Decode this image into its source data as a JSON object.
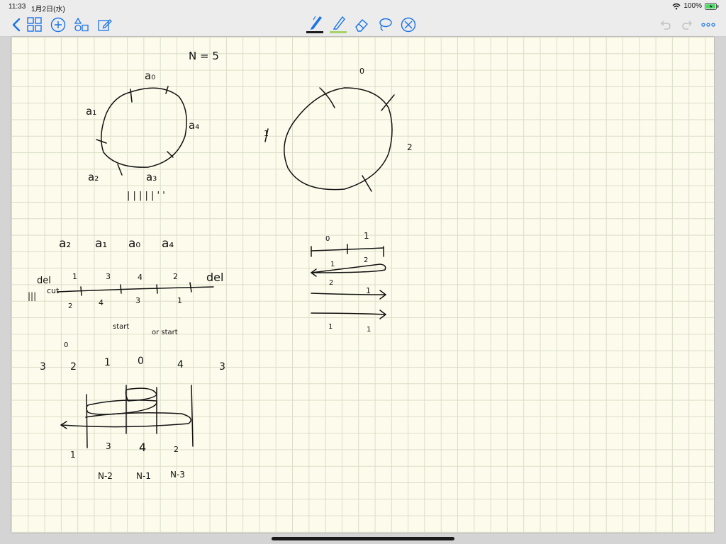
{
  "status_bar": {
    "time": "11:33",
    "date": "1月2日(水)",
    "battery": "100%"
  },
  "toolbar": {
    "left_icons": [
      "chevron-left-icon",
      "grid-icon",
      "plus-circle-icon",
      "shapes-icon",
      "edit-icon"
    ],
    "tools": [
      {
        "name": "pen-icon",
        "underline": "#1a1a1a"
      },
      {
        "name": "highlighter-icon",
        "underline": "#a6d36a"
      },
      {
        "name": "eraser-icon"
      },
      {
        "name": "lasso-icon"
      },
      {
        "name": "cancel-icon"
      }
    ],
    "right_icons": [
      "undo-icon",
      "redo-icon",
      "more-icon"
    ],
    "accent": "#1a73e8"
  },
  "notes": {
    "n_label": "N = 5",
    "circle_left_labels": [
      "a₀",
      "a₁",
      "a₄",
      "a₂",
      "a₃"
    ],
    "tally": "| | | | | ' '",
    "circle_right_labels": [
      "0",
      "1",
      "2"
    ],
    "seq_labels": [
      "a₂",
      "a₁",
      "a₀",
      "a₄"
    ],
    "line_top_nums": [
      "1",
      "3",
      "4",
      "2"
    ],
    "del_left": "del",
    "del_right": "del",
    "left_markers": "|||",
    "cut": "cut",
    "line_bottom_nums": [
      "2",
      "4",
      "3",
      "1"
    ],
    "start_labels": [
      "start",
      "or start"
    ],
    "zero_label": "0",
    "row_nums": [
      "3",
      "2",
      "1",
      "0",
      "4",
      "3"
    ],
    "right_line_nums_top": [
      "0",
      "1"
    ],
    "right_line_nums": [
      "1",
      "2",
      "2",
      "1",
      "1",
      "1"
    ],
    "bottom_nums": [
      "1",
      "3",
      "4",
      "2"
    ],
    "bottom_labels": [
      "N-2",
      "N-1",
      "N-3"
    ]
  }
}
